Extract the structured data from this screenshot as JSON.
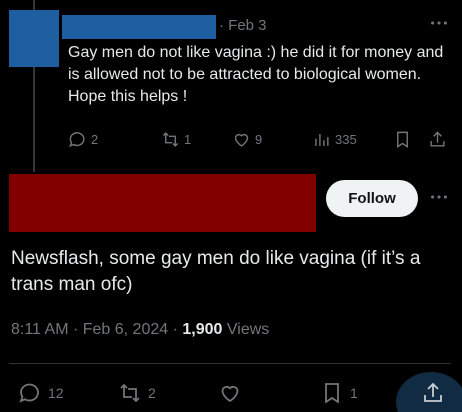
{
  "reply": {
    "date": "· Feb 3",
    "text": "Gay men do not like vagina :) he did it for money and is allowed not to be attracted to biological women. Hope this helps !",
    "replies": "2",
    "reposts": "1",
    "likes": "9",
    "views": "335"
  },
  "main": {
    "follow_label": "Follow",
    "text": "Newsflash, some gay men do like vagina (if it’s a trans man ofc)",
    "time": "8:11 AM",
    "date": "Feb 6, 2024",
    "views_count": "1,900",
    "views_label": "Views",
    "replies": "12",
    "reposts": "2",
    "bookmarks": "1"
  },
  "colors": {
    "redact_blue": "#1d5fa0",
    "redact_red": "#800000",
    "muted": "#71767b"
  }
}
